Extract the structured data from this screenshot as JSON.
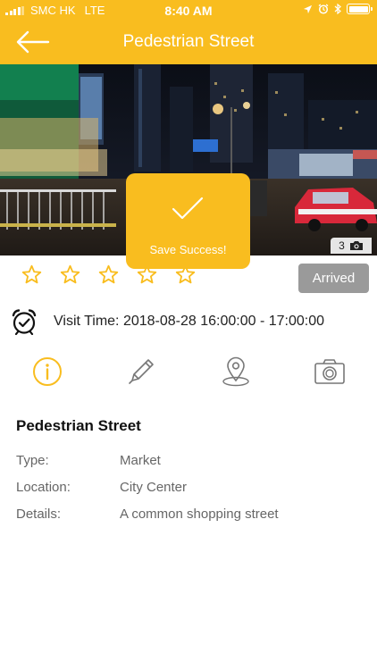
{
  "status_bar": {
    "carrier": "SMC HK",
    "network": "LTE",
    "time": "8:40 AM"
  },
  "nav": {
    "title": "Pedestrian Street",
    "back_icon": "arrow-left-icon"
  },
  "photo": {
    "count": "3",
    "camera_icon": "camera-icon"
  },
  "toast": {
    "message": "Save Success!",
    "icon": "checkmark-icon"
  },
  "rating": {
    "max_stars": 5,
    "filled": 0,
    "color": "#f9bd1f"
  },
  "status_button": {
    "label": "Arrived"
  },
  "visit": {
    "text": "Visit Time: 2018-08-28 16:00:00 - 17:00:00",
    "icon": "alarm-clock-icon"
  },
  "tabs": [
    {
      "name": "info",
      "icon": "info-icon",
      "active": true
    },
    {
      "name": "edit",
      "icon": "pencil-icon",
      "active": false
    },
    {
      "name": "location",
      "icon": "map-pin-icon",
      "active": false
    },
    {
      "name": "photos",
      "icon": "camera-icon",
      "active": false
    }
  ],
  "details": {
    "title": "Pedestrian Street",
    "rows": [
      {
        "label": "Type:",
        "value": "Market"
      },
      {
        "label": "Location:",
        "value": "City Center"
      },
      {
        "label": "Details:",
        "value": "A common shopping street"
      }
    ]
  },
  "colors": {
    "accent": "#f9bd1f",
    "button_gray": "#9a9a9a",
    "icon_gray": "#777777"
  }
}
